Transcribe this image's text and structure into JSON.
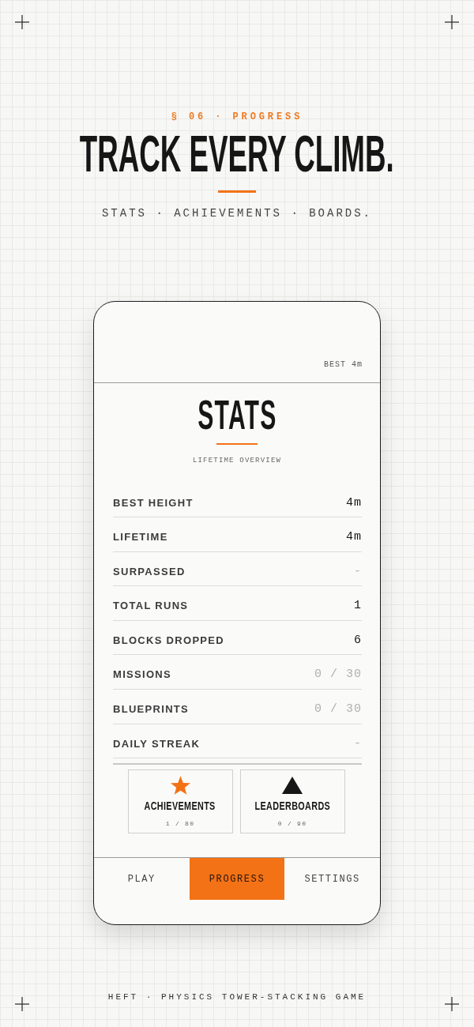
{
  "header": {
    "eyebrow": "§ 06 · PROGRESS",
    "title": "TRACK EVERY CLIMB.",
    "subtitle": "STATS · ACHIEVEMENTS · BOARDS."
  },
  "phone": {
    "best": "BEST 4m",
    "screen_title": "STATS",
    "screen_subtitle": "LIFETIME OVERVIEW",
    "stats": [
      {
        "label": "BEST HEIGHT",
        "value": "4m",
        "dimmed": false
      },
      {
        "label": "LIFETIME",
        "value": "4m",
        "dimmed": false
      },
      {
        "label": "SURPASSED",
        "value": "-",
        "dimmed": true
      },
      {
        "label": "TOTAL RUNS",
        "value": "1",
        "dimmed": false
      },
      {
        "label": "BLOCKS DROPPED",
        "value": "6",
        "dimmed": false
      },
      {
        "label": "MISSIONS",
        "value": "0 / 30",
        "dimmed": true
      },
      {
        "label": "BLUEPRINTS",
        "value": "0 / 30",
        "dimmed": true
      },
      {
        "label": "DAILY STREAK",
        "value": "-",
        "dimmed": true
      }
    ],
    "tiles": [
      {
        "kind": "star",
        "label": "ACHIEVEMENTS",
        "count": "1 / 80"
      },
      {
        "kind": "triangle",
        "label": "LEADERBOARDS",
        "count": "0 / 90"
      }
    ],
    "tabs": [
      {
        "label": "PLAY",
        "selected": false
      },
      {
        "label": "PROGRESS",
        "selected": true
      },
      {
        "label": "SETTINGS",
        "selected": false
      }
    ]
  },
  "footer": "HEFT · PHYSICS TOWER-STACKING GAME"
}
